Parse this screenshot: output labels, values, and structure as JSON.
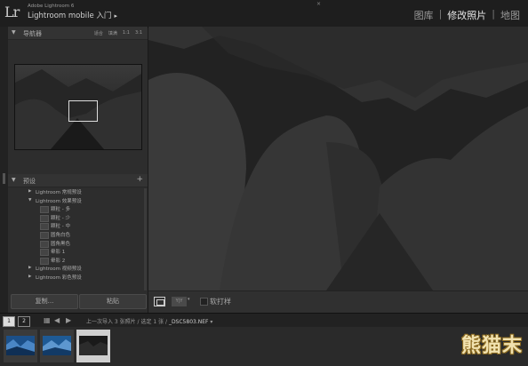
{
  "app": {
    "logo": "Lr",
    "subtitle": "Adobe Lightroom 6",
    "name": "Lightroom mobile 入门",
    "close_glyph": "×"
  },
  "modules": [
    "图库",
    "修改照片",
    "地图"
  ],
  "active_module": "修改照片",
  "navigator": {
    "title": "导航器",
    "options": [
      "适合",
      "填满",
      "1:1",
      "3:1"
    ]
  },
  "presets": {
    "title": "预设",
    "add_glyph": "+",
    "rows": [
      {
        "type": "folder",
        "expanded": false,
        "label": "Lightroom 常规预设"
      },
      {
        "type": "folder",
        "expanded": true,
        "label": "Lightroom 效果预设"
      },
      {
        "type": "item",
        "label": "颗粒 - 多"
      },
      {
        "type": "item",
        "label": "颗粒 - 少"
      },
      {
        "type": "item",
        "label": "颗粒 - 中"
      },
      {
        "type": "item",
        "label": "圆角白色"
      },
      {
        "type": "item",
        "label": "圆角黑色"
      },
      {
        "type": "item",
        "label": "晕影 1"
      },
      {
        "type": "item",
        "label": "晕影 2"
      },
      {
        "type": "folder",
        "expanded": false,
        "label": "Lightroom 视频预设"
      },
      {
        "type": "folder",
        "expanded": false,
        "label": "Lightroom 彩色预设"
      }
    ]
  },
  "buttons": {
    "copy": "复制...",
    "paste": "粘贴"
  },
  "toolbar": {
    "yy": "Y|Y",
    "yy_arrow": "▾",
    "softproof": "软打样"
  },
  "filmstrip": {
    "screen1": "1",
    "screen2": "2",
    "grid": "▦",
    "prev": "◀",
    "next": "▶",
    "path": "上一次导入  3 张照片 / 选定 1 张 / ",
    "filename": "_DSC5803.NEF",
    "filename_arrow": "▾"
  },
  "watermark": "熊猫末",
  "colors": {
    "accent": "#e6e6e6",
    "panel": "#2d2d2d",
    "background": "#1a1a1a"
  }
}
